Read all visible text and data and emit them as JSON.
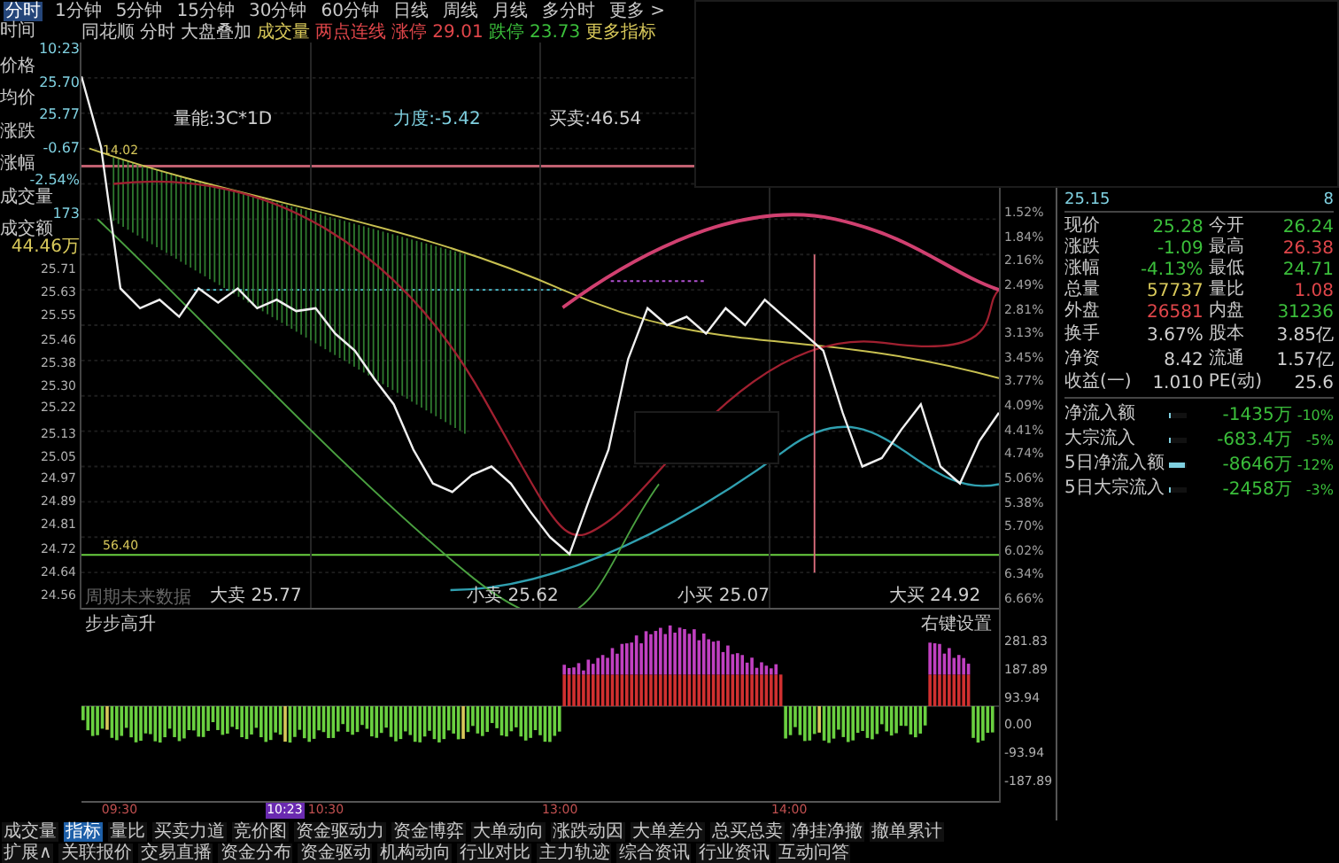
{
  "period_tabs": [
    {
      "label": "分时",
      "selected": true
    },
    {
      "label": "1分钟",
      "selected": false
    },
    {
      "label": "5分钟",
      "selected": false
    },
    {
      "label": "15分钟",
      "selected": false
    },
    {
      "label": "30分钟",
      "selected": false
    },
    {
      "label": "60分钟",
      "selected": false
    },
    {
      "label": "日线",
      "selected": false
    },
    {
      "label": "周线",
      "selected": false
    },
    {
      "label": "月线",
      "selected": false
    },
    {
      "label": "多分时",
      "selected": false
    },
    {
      "label": "更多 >",
      "selected": false
    }
  ],
  "toolbar": {
    "corner": "时间",
    "items": [
      {
        "text": "同花顺",
        "kind": "plain"
      },
      {
        "text": "分时",
        "kind": "plain"
      },
      {
        "text": "大盘叠加",
        "kind": "plain"
      },
      {
        "text": "成交量",
        "kind": "highlight"
      },
      {
        "text": "两点连线",
        "kind": "up"
      },
      {
        "text": "涨停 29.01",
        "kind": "up"
      },
      {
        "text": "跌停 23.73",
        "kind": "down"
      },
      {
        "text": "更多指标",
        "kind": "highlight"
      }
    ]
  },
  "quote_sidebar": [
    {
      "label": "10:23",
      "kind": "value"
    },
    {
      "label": "价格",
      "kind": "label"
    },
    {
      "label": "25.70",
      "kind": "value"
    },
    {
      "label": "均价",
      "kind": "label"
    },
    {
      "label": "25.77",
      "kind": "value"
    },
    {
      "label": "涨跌",
      "kind": "label"
    },
    {
      "label": "-0.67",
      "kind": "value"
    },
    {
      "label": "涨幅",
      "kind": "label"
    },
    {
      "label": "-2.54%",
      "kind": "value"
    },
    {
      "label": "成交量",
      "kind": "label"
    },
    {
      "label": "173",
      "kind": "value"
    },
    {
      "label": "成交额",
      "kind": "label"
    },
    {
      "label": "44.46万",
      "kind": "highlight"
    }
  ],
  "percent_axis": [
    "1.52%",
    "1.84%",
    "2.16%",
    "2.49%",
    "2.81%",
    "3.13%",
    "3.45%",
    "3.77%",
    "4.09%",
    "4.41%",
    "4.74%",
    "5.06%",
    "5.38%",
    "5.70%",
    "6.02%",
    "6.34%",
    "6.66%"
  ],
  "chart_labels": {
    "volume_energy": "量能:3C*1D",
    "strength": "力度:-5.42",
    "buy_sell": "买卖:46.54",
    "marker_high": "14.02",
    "marker_low": "56.40",
    "note": "周期未来数据"
  },
  "price_chart": {
    "chart_data": {
      "type": "line",
      "ylim": [
        24.51,
        26.51
      ],
      "grid": true,
      "yticks": [
        {
          "value": 25.71,
          "label": "25.71"
        },
        {
          "value": 25.63,
          "label": "25.63"
        },
        {
          "value": 25.55,
          "label": "25.55"
        },
        {
          "value": 25.46,
          "label": "25.46"
        },
        {
          "value": 25.38,
          "label": "25.38"
        },
        {
          "value": 25.3,
          "label": "25.30"
        },
        {
          "value": 25.22,
          "label": "25.22"
        },
        {
          "value": 25.13,
          "label": "25.13"
        },
        {
          "value": 25.05,
          "label": "25.05"
        },
        {
          "value": 24.97,
          "label": "24.97"
        },
        {
          "value": 24.89,
          "label": "24.89"
        },
        {
          "value": 24.81,
          "label": "24.81"
        },
        {
          "value": 24.72,
          "label": "24.72"
        },
        {
          "value": 24.64,
          "label": "24.64"
        },
        {
          "value": 24.56,
          "label": "24.56"
        }
      ],
      "series": [
        {
          "color": "#f0f0f0",
          "values": [
            26.39,
            26.14,
            25.64,
            25.57,
            25.6,
            25.54,
            25.64,
            25.59,
            25.64,
            25.57,
            25.6,
            25.56,
            25.57,
            25.48,
            25.42,
            25.32,
            25.23,
            25.07,
            24.95,
            24.92,
            24.98,
            25.01,
            24.95,
            24.85,
            24.76,
            24.7,
            24.89,
            25.07,
            25.39,
            25.57,
            25.51,
            25.54,
            25.48,
            25.57,
            25.51,
            25.6,
            25.54,
            25.48,
            25.42,
            25.2,
            25.01,
            25.04,
            25.14,
            25.23,
            25.01,
            24.95,
            25.1,
            25.2
          ]
        }
      ]
    }
  },
  "trade_markers": [
    {
      "text": "大卖 25.77"
    },
    {
      "text": "小卖 25.62"
    },
    {
      "text": "小买 25.07"
    },
    {
      "text": "大买 24.92"
    }
  ],
  "order_book": [
    {
      "price": "25.15",
      "volume": "8"
    }
  ],
  "quote_table": [
    [
      {
        "label": "现价",
        "value": "25.28",
        "color": "#3bbf3b"
      },
      {
        "label": "今开",
        "value": "26.24",
        "color": "#3bbf3b"
      }
    ],
    [
      {
        "label": "涨跌",
        "value": "-1.09",
        "color": "#3bbf3b"
      },
      {
        "label": "最高",
        "value": "26.38",
        "color": "#e0464a"
      }
    ],
    [
      {
        "label": "涨幅",
        "value": "-4.13%",
        "color": "#3bbf3b"
      },
      {
        "label": "最低",
        "value": "24.71",
        "color": "#3bbf3b"
      }
    ],
    [
      {
        "label": "总量",
        "value": "57737",
        "color": "#d8c85a"
      },
      {
        "label": "量比",
        "value": "1.08",
        "color": "#e0464a"
      }
    ],
    [
      {
        "label": "外盘",
        "value": "26581",
        "color": "#e0464a"
      },
      {
        "label": "内盘",
        "value": "31236",
        "color": "#3bbf3b"
      }
    ],
    [
      {
        "label": "换手",
        "value": "3.67%",
        "color": "#d0d0d0"
      },
      {
        "label": "股本",
        "value": "3.85亿",
        "color": "#d0d0d0"
      }
    ],
    [
      {
        "label": "净资",
        "value": "8.42",
        "color": "#d0d0d0"
      },
      {
        "label": "流通",
        "value": "1.57亿",
        "color": "#d0d0d0"
      }
    ],
    [
      {
        "label": "收益(一)",
        "value": "1.010",
        "color": "#d0d0d0"
      },
      {
        "label": "PE(动)",
        "value": "25.6",
        "color": "#d0d0d0"
      }
    ]
  ],
  "fund_flow": [
    {
      "label": "净流入额",
      "level": 0.05,
      "value": "-1435万",
      "pct": "-10%"
    },
    {
      "label": "大宗流入",
      "level": 0.03,
      "value": "-683.4万",
      "pct": "-5%"
    },
    {
      "label": "5日净流入额",
      "level": 0.9,
      "value": "-8646万",
      "pct": "-12%"
    },
    {
      "label": "5日大宗流入",
      "level": 0.08,
      "value": "-2458万",
      "pct": "-3%"
    }
  ],
  "indicator": {
    "title": "步步高升",
    "settings": "右键设置",
    "axis": [
      "281.83",
      "187.89",
      "93.94",
      "0.00",
      "-93.94",
      "-187.89"
    ]
  },
  "time_axis": [
    {
      "text": "09:30",
      "selected": false
    },
    {
      "text": "10:23",
      "selected": true
    },
    {
      "text": "10:30",
      "selected": false
    },
    {
      "text": "13:00",
      "selected": false
    },
    {
      "text": "14:00",
      "selected": false
    }
  ],
  "bottom_tabs": [
    [
      {
        "label": "成交量",
        "selected": false
      },
      {
        "label": "指标",
        "selected": true
      },
      {
        "label": "量比",
        "selected": false
      },
      {
        "label": "买卖力道",
        "selected": false
      },
      {
        "label": "竞价图",
        "selected": false
      },
      {
        "label": "资金驱动力",
        "selected": false
      },
      {
        "label": "资金博弈",
        "selected": false
      },
      {
        "label": "大单动向",
        "selected": false
      },
      {
        "label": "涨跌动因",
        "selected": false
      },
      {
        "label": "大单差分",
        "selected": false
      },
      {
        "label": "总买总卖",
        "selected": false
      },
      {
        "label": "净挂净撤",
        "selected": false
      },
      {
        "label": "撤单累计",
        "selected": false
      }
    ],
    [
      {
        "label": "扩展∧",
        "selected": false
      },
      {
        "label": "关联报价",
        "selected": false
      },
      {
        "label": "交易直播",
        "selected": false
      },
      {
        "label": "资金分布",
        "selected": false
      },
      {
        "label": "资金驱动",
        "selected": false
      },
      {
        "label": "机构动向",
        "selected": false
      },
      {
        "label": "行业对比",
        "selected": false
      },
      {
        "label": "主力轨迹",
        "selected": false
      },
      {
        "label": "综合资讯",
        "selected": false
      },
      {
        "label": "行业资讯",
        "selected": false
      },
      {
        "label": "互动问答",
        "selected": false
      }
    ]
  ]
}
